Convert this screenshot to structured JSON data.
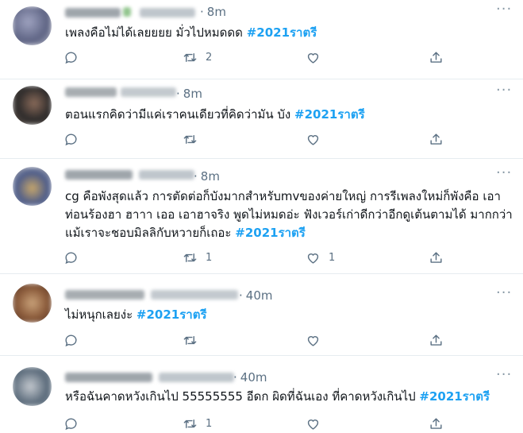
{
  "tweets": [
    {
      "time": "8m",
      "text": "เพลงคือไม่ได้เลยยยย มั่วไปหมดดด ",
      "hashtag": "#2021ราตรี",
      "reply_count": "",
      "retweet_count": "2",
      "like_count": "",
      "avatar_colors": [
        "#6a6f8f",
        "#b7b9c9"
      ]
    },
    {
      "time": "8m",
      "text": "ตอนแรกคิดว่ามีแค่เราคนเดียวที่คิดว่ามัน บัง ",
      "hashtag": "#2021ราตรี",
      "reply_count": "",
      "retweet_count": "",
      "like_count": "",
      "avatar_colors": [
        "#2c2a2a",
        "#8a6b5a"
      ]
    },
    {
      "time": "8m",
      "text": "cg คือพังสุดแล้ว การตัดต่อก็บังมากสำหรับmvของค่ายใหญ่ การรีเพลงใหม่ก็พังคือ เอาท่อนร้องฮา ฮาาา เออ เอาฮาจริง พูดไม่หมดอ่ะ ฟังเวอร์เก่าดีกว่าอีกดูเต้นตามได้ มากกว่า แม้เราจะชอบมิลลิกับหวายก็เถอะ ",
      "hashtag": "#2021ราตรี",
      "reply_count": "",
      "retweet_count": "1",
      "like_count": "1",
      "avatar_colors": [
        "#c9a86a",
        "#4a5a8a"
      ]
    },
    {
      "time": "40m",
      "text": "ไม่หนุกเลยง่ะ ",
      "hashtag": "#2021ราตรี",
      "reply_count": "",
      "retweet_count": "",
      "like_count": "",
      "avatar_colors": [
        "#8a5a3a",
        "#c9a27a"
      ]
    },
    {
      "time": "40m",
      "text": "หรือฉันคาดหวังเกินไป 55555555 อีดก ผิดที่ฉันเอง ที่คาดหวังเกินไป ",
      "hashtag": "#2021ราตรี",
      "reply_count": "",
      "retweet_count": "1",
      "like_count": "",
      "avatar_colors": [
        "#5a6a7a",
        "#c4c9cf"
      ]
    }
  ],
  "icons": {
    "reply": "reply-icon",
    "retweet": "retweet-icon",
    "like": "like-icon",
    "share": "share-icon",
    "more": "more-options-icon"
  },
  "colors": {
    "hashtag": "#1da1f2",
    "secondary_text": "#5b7083",
    "divider": "#e6ecf0"
  }
}
